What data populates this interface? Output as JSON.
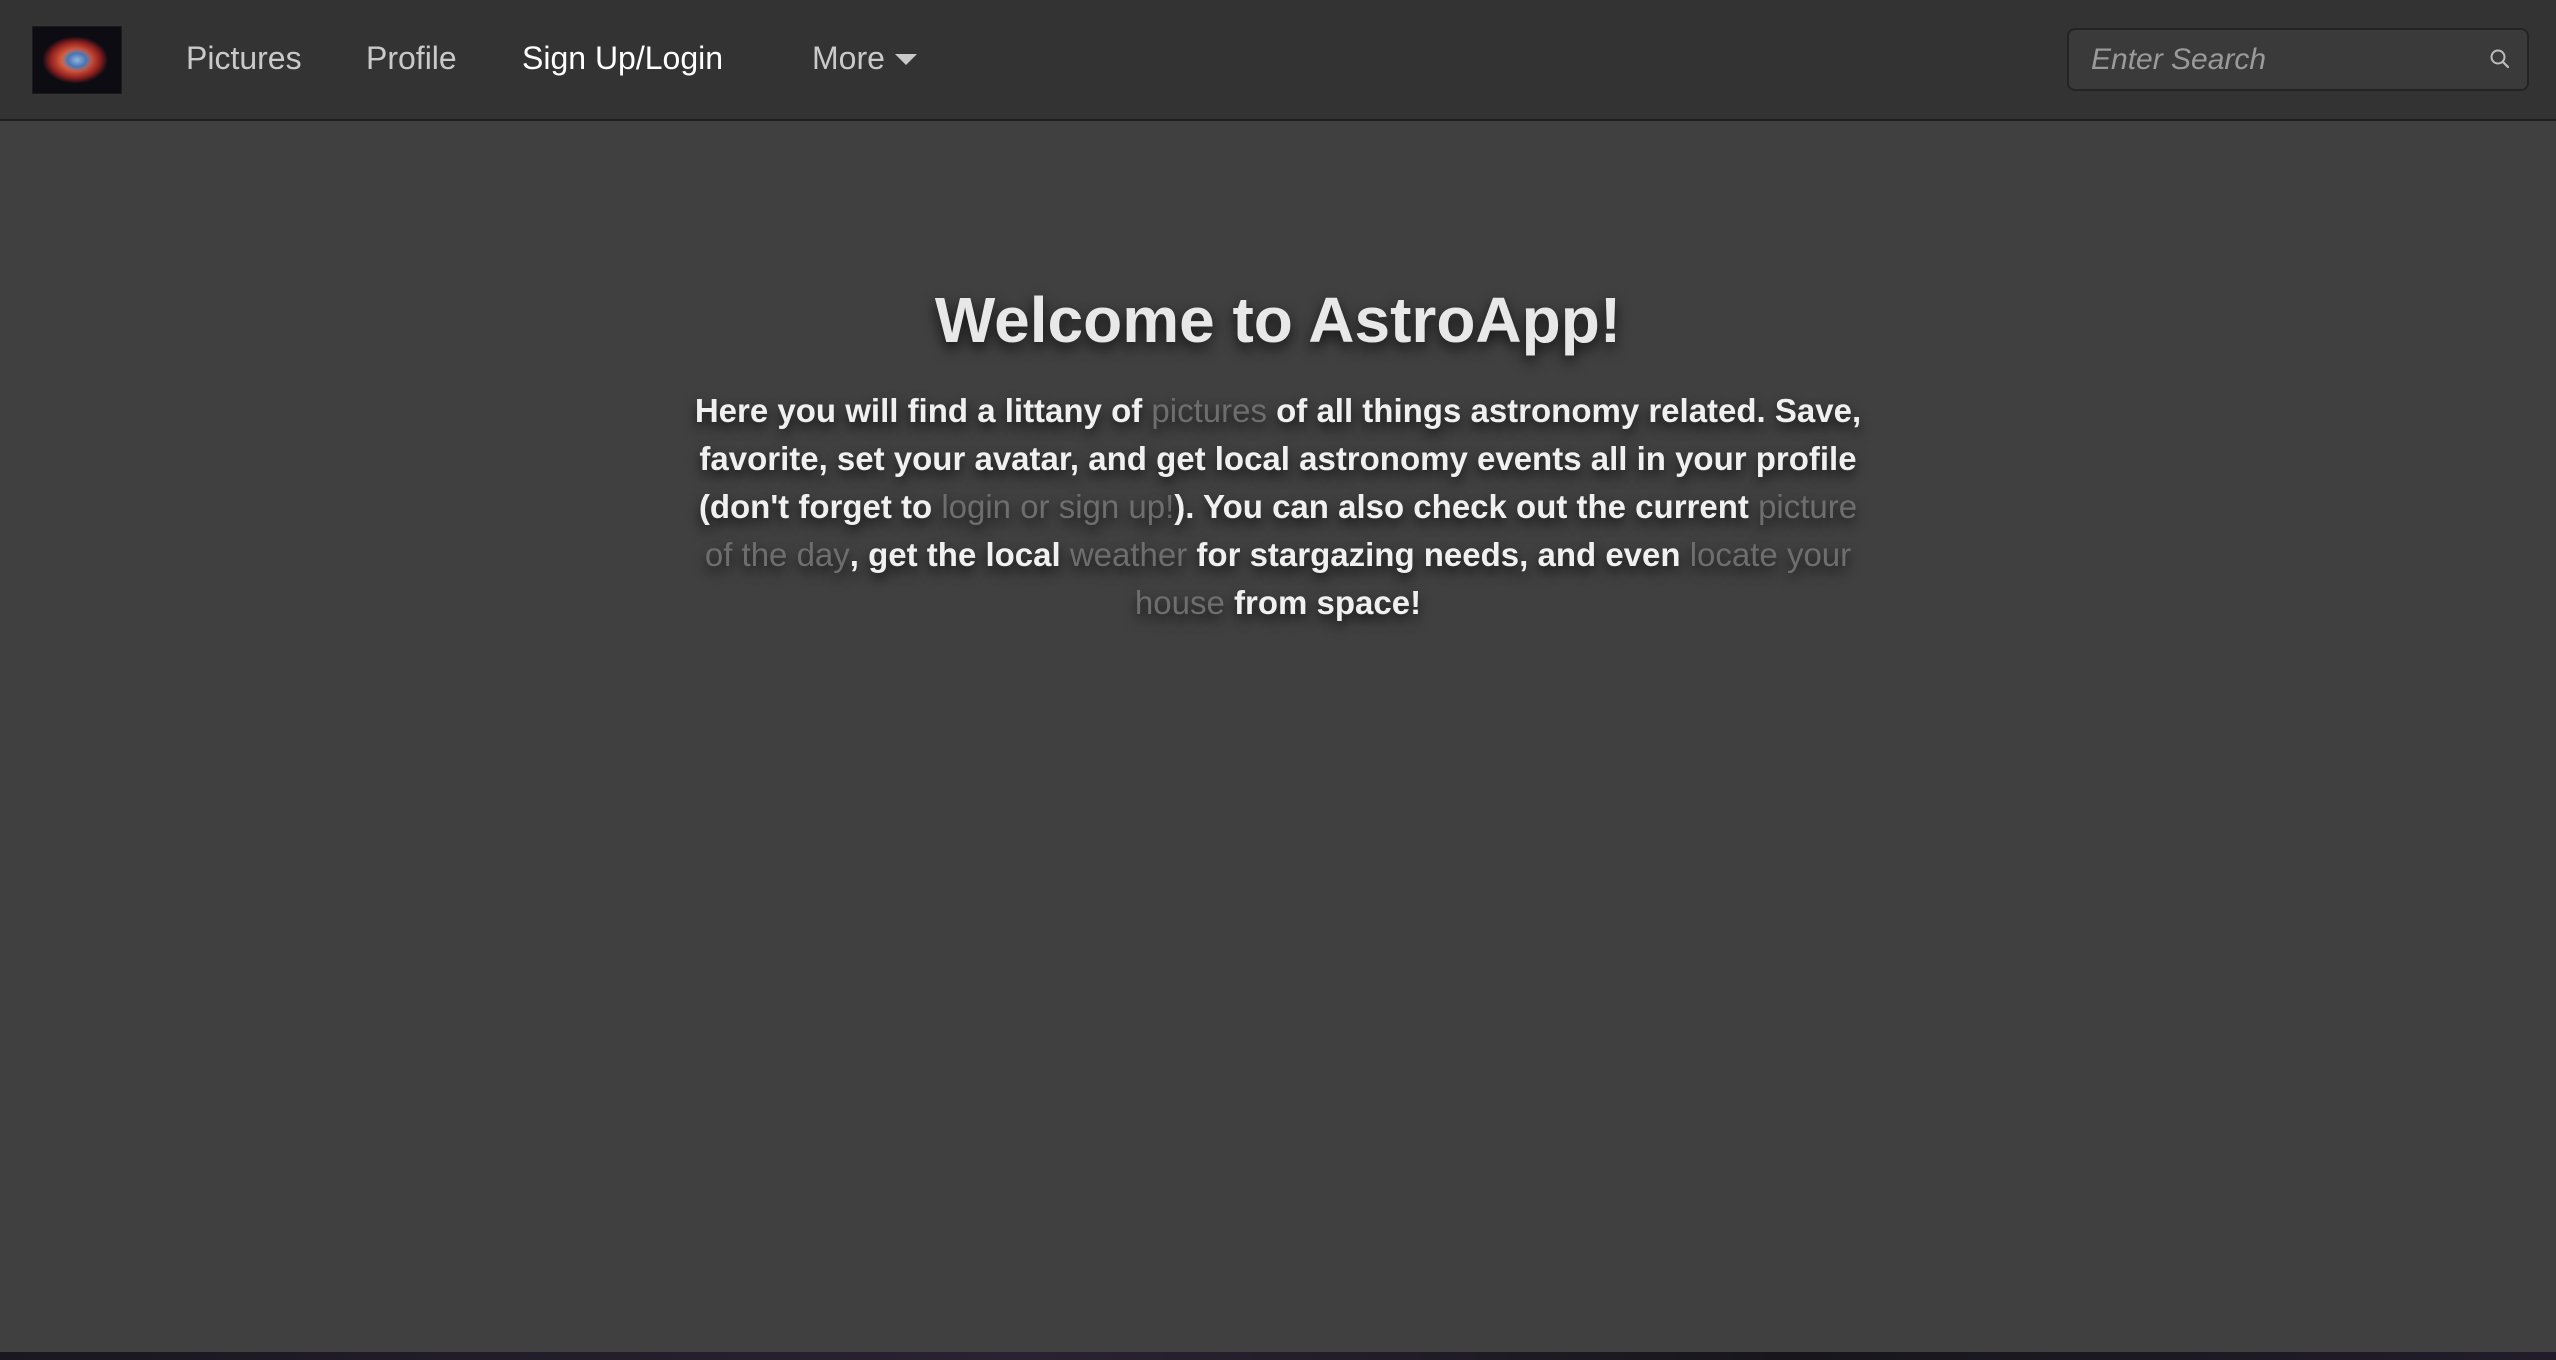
{
  "nav": {
    "logo_icon": "helix-nebula-logo-icon",
    "links": [
      {
        "label": "Pictures",
        "active": false
      },
      {
        "label": "Profile",
        "active": false
      },
      {
        "label": "Sign Up/Login",
        "active": true
      },
      {
        "label": "More",
        "active": false,
        "has_dropdown": true
      }
    ],
    "more_icon": "caret-down-icon",
    "search": {
      "placeholder": "Enter Search",
      "value": "",
      "icon": "search-icon"
    }
  },
  "hero": {
    "title": "Welcome to AstroApp!",
    "text": {
      "p1": "Here you will find a littany of ",
      "link_pictures": "pictures",
      "p2": " of all things astronomy related. Save, favorite, set your avatar, and get local astronomy events all in your profile (don't forget to ",
      "link_login": "login or sign up!",
      "p3": "). You can also check out the current ",
      "link_potd": "picture of the day",
      "p4": ", get the local ",
      "link_weather": "weather",
      "p5": " for stargazing needs, and even ",
      "link_locate": "locate your house",
      "p6": " from space!"
    }
  },
  "colors": {
    "navbar": "#333333",
    "page_background": "#404040",
    "text": "#f0f0f0",
    "link": "#6e6e6e"
  }
}
